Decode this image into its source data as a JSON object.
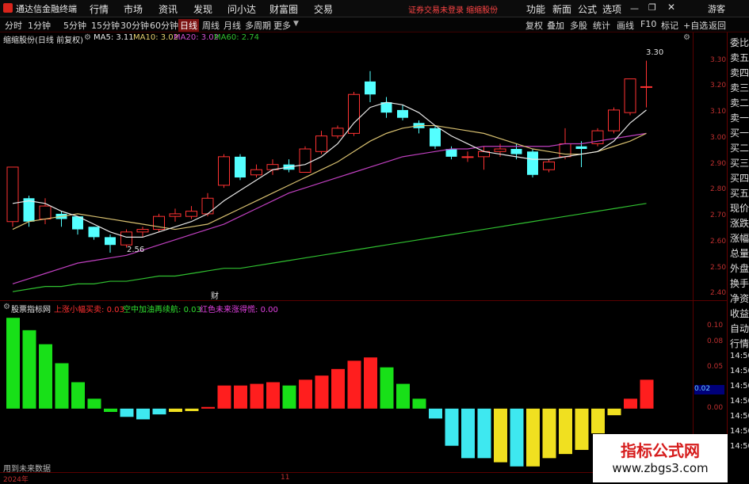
{
  "menubar": {
    "app_title": "通达信金融终端",
    "items": [
      "行情",
      "市场",
      "资讯",
      "发现",
      "问小达",
      "财富圈",
      "交易"
    ],
    "login_status": "证券交易未登录 缩缩股份",
    "right_items": [
      "功能",
      "新面",
      "公式",
      "选项"
    ],
    "guest_label": "游客",
    "colors": {
      "login_status": "#ff4545"
    }
  },
  "periodbar": {
    "periods": [
      "分时",
      "1分钟",
      "5分钟",
      "15分钟",
      "30分钟",
      "60分钟",
      "日线",
      "周线",
      "月线",
      "多周期",
      "更多"
    ],
    "active": "日线",
    "tools": [
      "复权",
      "叠加",
      "多股",
      "统计",
      "画线",
      "F10",
      "标记",
      "+自选",
      "返回"
    ]
  },
  "stock_info": {
    "title": "缩缩股份(日线 前复权)",
    "ma": [
      {
        "label": "MA5:",
        "value": "3.11",
        "color": "#e8e8e8"
      },
      {
        "label": "MA10:",
        "value": "3.02",
        "color": "#e6d070"
      },
      {
        "label": "MA20:",
        "value": "3.02",
        "color": "#d050d0"
      },
      {
        "label": "MA60:",
        "value": "2.74",
        "color": "#30c030"
      }
    ]
  },
  "price_axis": [
    "3.30",
    "3.20",
    "3.10",
    "3.00",
    "2.90",
    "2.80",
    "2.70",
    "2.60",
    "2.50",
    "2.40"
  ],
  "annotations": {
    "high": "3.30",
    "low": "2.56",
    "event": "财"
  },
  "indicator": {
    "name": "股票指标网",
    "lines": [
      {
        "label": "上涨小幅买卖:",
        "value": "0.03",
        "color": "#ff3030"
      },
      {
        "label": "空中加油再续航:",
        "value": "0.03",
        "color": "#30e030"
      },
      {
        "label": "红色未来涨得慌:",
        "value": "0.00",
        "color": "#e040e0"
      }
    ]
  },
  "indicator_axis": [
    "0.10",
    "0.08",
    "0.05",
    "0.02",
    "0.00"
  ],
  "current_value_badge": "0.02",
  "right_panel": [
    "委比",
    "卖五",
    "卖四",
    "卖三",
    "卖二",
    "卖一",
    "买一",
    "买二",
    "买三",
    "买四",
    "买五",
    "现价",
    "涨跌",
    "涨幅",
    "总量",
    "外盘",
    "换手",
    "净资",
    "收益",
    "自动",
    "行情",
    "14:50",
    "14:50",
    "14:50",
    "14:50",
    "14:50",
    "14:50",
    "14:50"
  ],
  "date_axis": [
    "2024年",
    "11"
  ],
  "data_note": "用到未来数据",
  "watermark": {
    "title": "指标公式网",
    "url": "www.zbgs3.com"
  },
  "chart_data": {
    "type": "candlestick",
    "price_ylim": [
      2.38,
      3.36
    ],
    "candles": [
      {
        "o": 2.68,
        "c": 2.89,
        "h": 2.89,
        "l": 2.66
      },
      {
        "o": 2.77,
        "c": 2.68,
        "h": 2.78,
        "l": 2.66
      },
      {
        "o": 2.69,
        "c": 2.74,
        "h": 2.77,
        "l": 2.67
      },
      {
        "o": 2.71,
        "c": 2.69,
        "h": 2.72,
        "l": 2.66
      },
      {
        "o": 2.7,
        "c": 2.65,
        "h": 2.7,
        "l": 2.63
      },
      {
        "o": 2.66,
        "c": 2.62,
        "h": 2.66,
        "l": 2.61
      },
      {
        "o": 2.62,
        "c": 2.59,
        "h": 2.63,
        "l": 2.56
      },
      {
        "o": 2.59,
        "c": 2.64,
        "h": 2.65,
        "l": 2.58
      },
      {
        "o": 2.64,
        "c": 2.65,
        "h": 2.66,
        "l": 2.62
      },
      {
        "o": 2.65,
        "c": 2.7,
        "h": 2.71,
        "l": 2.64
      },
      {
        "o": 2.7,
        "c": 2.71,
        "h": 2.73,
        "l": 2.68
      },
      {
        "o": 2.7,
        "c": 2.72,
        "h": 2.74,
        "l": 2.69
      },
      {
        "o": 2.71,
        "c": 2.77,
        "h": 2.79,
        "l": 2.7
      },
      {
        "o": 2.82,
        "c": 2.93,
        "h": 2.94,
        "l": 2.81
      },
      {
        "o": 2.93,
        "c": 2.85,
        "h": 2.94,
        "l": 2.84
      },
      {
        "o": 2.86,
        "c": 2.88,
        "h": 2.9,
        "l": 2.85
      },
      {
        "o": 2.88,
        "c": 2.9,
        "h": 2.92,
        "l": 2.86
      },
      {
        "o": 2.9,
        "c": 2.88,
        "h": 2.92,
        "l": 2.87
      },
      {
        "o": 2.87,
        "c": 2.96,
        "h": 2.97,
        "l": 2.87
      },
      {
        "o": 2.95,
        "c": 3.01,
        "h": 3.03,
        "l": 2.94
      },
      {
        "o": 3.01,
        "c": 3.04,
        "h": 3.05,
        "l": 3.0
      },
      {
        "o": 3.02,
        "c": 3.17,
        "h": 3.18,
        "l": 3.01
      },
      {
        "o": 3.22,
        "c": 3.17,
        "h": 3.26,
        "l": 3.14
      },
      {
        "o": 3.14,
        "c": 3.1,
        "h": 3.16,
        "l": 3.08
      },
      {
        "o": 3.11,
        "c": 3.08,
        "h": 3.13,
        "l": 3.07
      },
      {
        "o": 3.06,
        "c": 3.04,
        "h": 3.07,
        "l": 3.02
      },
      {
        "o": 3.04,
        "c": 2.97,
        "h": 3.05,
        "l": 2.96
      },
      {
        "o": 2.96,
        "c": 2.93,
        "h": 2.97,
        "l": 2.92
      },
      {
        "o": 2.93,
        "c": 2.93,
        "h": 2.95,
        "l": 2.91
      },
      {
        "o": 2.93,
        "c": 2.95,
        "h": 2.97,
        "l": 2.88
      },
      {
        "o": 2.95,
        "c": 2.96,
        "h": 2.98,
        "l": 2.93
      },
      {
        "o": 2.96,
        "c": 2.94,
        "h": 2.98,
        "l": 2.92
      },
      {
        "o": 2.95,
        "c": 2.86,
        "h": 2.96,
        "l": 2.85
      },
      {
        "o": 2.88,
        "c": 2.91,
        "h": 2.92,
        "l": 2.87
      },
      {
        "o": 2.93,
        "c": 2.98,
        "h": 3.04,
        "l": 2.92
      },
      {
        "o": 2.97,
        "c": 2.96,
        "h": 2.99,
        "l": 2.89
      },
      {
        "o": 2.98,
        "c": 3.03,
        "h": 3.04,
        "l": 2.97
      },
      {
        "o": 3.03,
        "c": 3.11,
        "h": 3.12,
        "l": 3.02
      },
      {
        "o": 3.1,
        "c": 3.23,
        "h": 3.23,
        "l": 3.09
      },
      {
        "o": 3.2,
        "c": 3.2,
        "h": 3.3,
        "l": 3.12
      }
    ],
    "ma5": [
      2.75,
      2.76,
      2.75,
      2.72,
      2.7,
      2.67,
      2.64,
      2.62,
      2.62,
      2.64,
      2.66,
      2.68,
      2.71,
      2.76,
      2.8,
      2.84,
      2.88,
      2.89,
      2.9,
      2.93,
      2.98,
      3.06,
      3.12,
      3.14,
      3.13,
      3.1,
      3.05,
      3.01,
      2.98,
      2.95,
      2.94,
      2.93,
      2.92,
      2.92,
      2.93,
      2.94,
      2.95,
      2.99,
      3.06,
      3.11
    ],
    "ma10": [
      2.65,
      2.68,
      2.69,
      2.7,
      2.71,
      2.7,
      2.69,
      2.68,
      2.67,
      2.66,
      2.65,
      2.66,
      2.67,
      2.7,
      2.73,
      2.76,
      2.79,
      2.82,
      2.85,
      2.88,
      2.91,
      2.95,
      2.99,
      3.02,
      3.04,
      3.05,
      3.05,
      3.04,
      3.03,
      3.02,
      3.0,
      2.98,
      2.96,
      2.95,
      2.94,
      2.94,
      2.95,
      2.97,
      2.99,
      3.02
    ],
    "ma20": [
      2.44,
      2.46,
      2.48,
      2.5,
      2.52,
      2.53,
      2.54,
      2.55,
      2.57,
      2.59,
      2.61,
      2.63,
      2.65,
      2.67,
      2.7,
      2.73,
      2.76,
      2.79,
      2.81,
      2.83,
      2.85,
      2.87,
      2.89,
      2.91,
      2.93,
      2.94,
      2.95,
      2.96,
      2.96,
      2.97,
      2.97,
      2.97,
      2.97,
      2.97,
      2.98,
      2.98,
      2.99,
      3.0,
      3.01,
      3.02
    ],
    "ma60": [
      2.41,
      2.42,
      2.43,
      2.43,
      2.44,
      2.44,
      2.45,
      2.45,
      2.46,
      2.47,
      2.47,
      2.48,
      2.49,
      2.5,
      2.5,
      2.51,
      2.52,
      2.53,
      2.54,
      2.55,
      2.56,
      2.57,
      2.58,
      2.59,
      2.6,
      2.61,
      2.62,
      2.63,
      2.64,
      2.65,
      2.66,
      2.67,
      2.68,
      2.69,
      2.7,
      2.71,
      2.72,
      2.73,
      2.74,
      2.75
    ],
    "indicator_ylim": [
      -0.075,
      0.115
    ],
    "indicator_values": [
      0.11,
      0.095,
      0.078,
      0.055,
      0.032,
      0.012,
      -0.004,
      -0.01,
      -0.013,
      -0.007,
      -0.004,
      -0.003,
      0.002,
      0.028,
      0.028,
      0.03,
      0.032,
      0.028,
      0.035,
      0.04,
      0.048,
      0.058,
      0.062,
      0.05,
      0.03,
      0.012,
      -0.012,
      -0.045,
      -0.06,
      -0.06,
      -0.065,
      -0.07,
      -0.07,
      -0.06,
      -0.055,
      -0.05,
      -0.03,
      -0.008,
      0.012,
      0.035
    ],
    "indicator_colors": [
      "green",
      "green",
      "green",
      "green",
      "green",
      "green",
      "green",
      "cyan",
      "cyan",
      "cyan",
      "yellow",
      "yellow",
      "red",
      "red",
      "red",
      "red",
      "red",
      "green",
      "red",
      "red",
      "red",
      "red",
      "red",
      "green",
      "green",
      "green",
      "cyan",
      "cyan",
      "cyan",
      "cyan",
      "yellow",
      "cyan",
      "yellow",
      "yellow",
      "yellow",
      "yellow",
      "yellow",
      "yellow",
      "red",
      "red"
    ]
  }
}
